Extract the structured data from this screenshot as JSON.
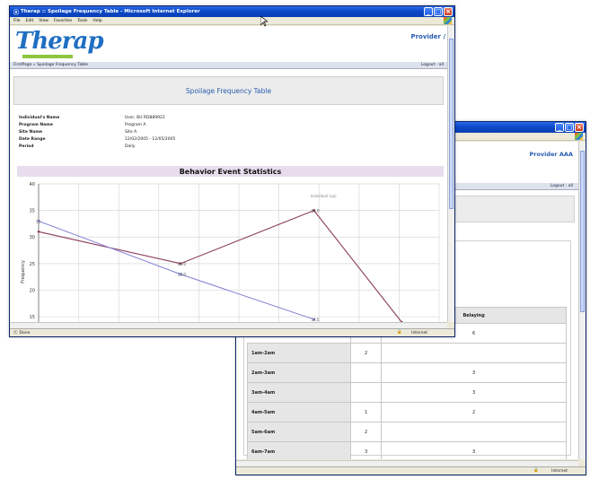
{
  "back_window": {
    "provider": "Provider AAA",
    "logout": "Logout - all",
    "status_zone": "Internet",
    "table": {
      "columns": [
        "",
        "",
        "Belaying"
      ],
      "rows": [
        {
          "label": "",
          "col1": "",
          "col2": "6"
        },
        {
          "label": "1am-2am",
          "col1": "2",
          "col2": ""
        },
        {
          "label": "2am-3am",
          "col1": "",
          "col2": "3"
        },
        {
          "label": "3am-4am",
          "col1": "",
          "col2": "3"
        },
        {
          "label": "4am-5am",
          "col1": "1",
          "col2": "2"
        },
        {
          "label": "5am-6am",
          "col1": "2",
          "col2": ""
        },
        {
          "label": "6am-7am",
          "col1": "3",
          "col2": "3"
        }
      ]
    }
  },
  "front_window": {
    "title": "Therap :: Spoilage Frequency Table - Microsoft Internet Explorer",
    "menu": [
      "File",
      "Edit",
      "View",
      "Favorites",
      "Tools",
      "Help"
    ],
    "logo": "Therap",
    "provider": "Provider /",
    "breadcrumb": "FirstPage  »  Spoilage Frequency Table",
    "logout": "Logout - all",
    "page_title": "Spoilage Frequency Table",
    "info": [
      {
        "label": "Individual's Name",
        "value": "User, BU RD889922"
      },
      {
        "label": "Program Name",
        "value": "Program A"
      },
      {
        "label": "Site Name",
        "value": "Site A"
      },
      {
        "label": "Date Range",
        "value": "12/02/2005 - 12/05/2005"
      },
      {
        "label": "Period",
        "value": "Daily"
      }
    ],
    "status_left": "Done",
    "status_zone": "Internet"
  },
  "chart_data": {
    "type": "line",
    "title": "Behavior Event Statistics",
    "ylabel": "Frequency",
    "ylim": [
      14,
      40
    ],
    "yticks": [
      15,
      20,
      25,
      30,
      35,
      40
    ],
    "grid": true,
    "annotation": "Individual (up)",
    "series": [
      {
        "color": "#8a3a5a",
        "points": [
          [
            0,
            31
          ],
          [
            3.4,
            25
          ],
          [
            6.6,
            35
          ],
          [
            8.7,
            14
          ]
        ],
        "labels": [
          "",
          "25.0",
          "35.0",
          ""
        ]
      },
      {
        "color": "#8a8ad8",
        "points": [
          [
            0,
            33
          ],
          [
            3.4,
            23
          ],
          [
            6.6,
            14.5
          ]
        ],
        "labels": [
          "33",
          "23.0",
          "14.5"
        ]
      }
    ],
    "xlim": [
      0,
      9.6
    ]
  }
}
